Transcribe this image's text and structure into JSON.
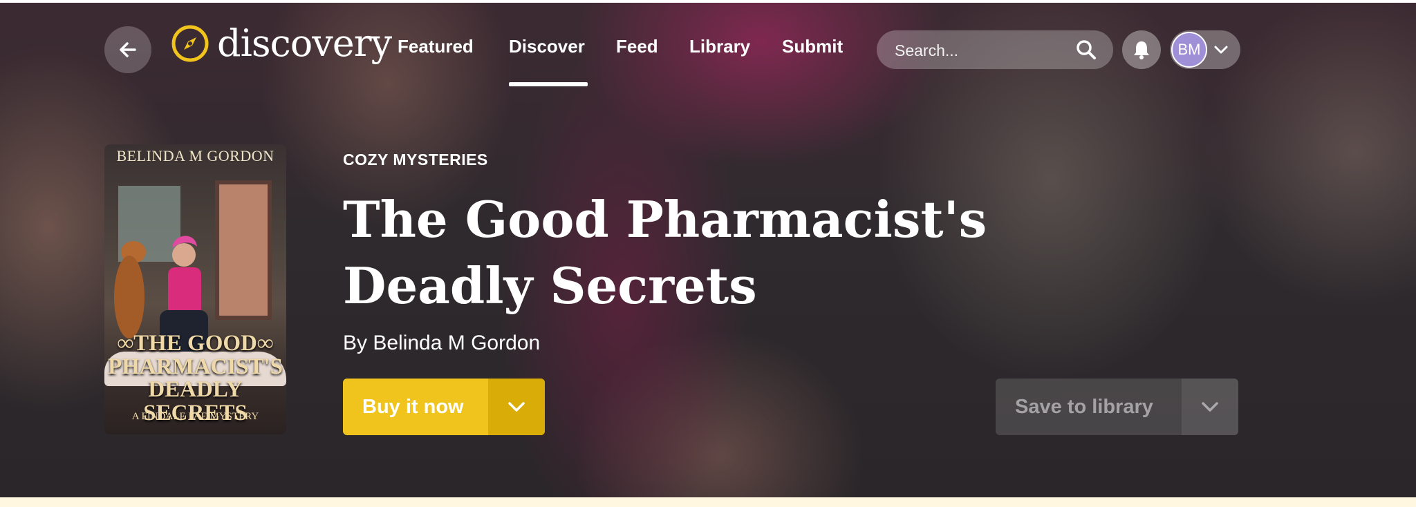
{
  "brand": {
    "name": "discovery",
    "accent": "#f0c41c"
  },
  "nav": {
    "items": [
      {
        "label": "Featured",
        "active": false
      },
      {
        "label": "Discover",
        "active": true
      },
      {
        "label": "Feed",
        "active": false
      },
      {
        "label": "Library",
        "active": false
      },
      {
        "label": "Submit",
        "active": false
      }
    ]
  },
  "search": {
    "placeholder": "Search..."
  },
  "user": {
    "initials": "BM",
    "avatar_color": "#9f8fd6"
  },
  "book": {
    "genre": "COZY MYSTERIES",
    "title": "The Good Pharmacist's Deadly Secrets",
    "byline": "By Belinda M Gordon",
    "cover": {
      "author": "BELINDA M GORDON",
      "title_lines": [
        "∞THE GOOD∞",
        "PHARMACIST'S",
        "DEADLY SECRETS"
      ],
      "series": "A FINDALE FAE MYSTERY"
    }
  },
  "actions": {
    "buy_label": "Buy it now",
    "save_label": "Save to library"
  },
  "icons": {
    "back": "arrow-left-icon",
    "logo": "compass-icon",
    "search": "search-icon",
    "bell": "bell-icon",
    "dropdown": "chevron-down-icon"
  }
}
